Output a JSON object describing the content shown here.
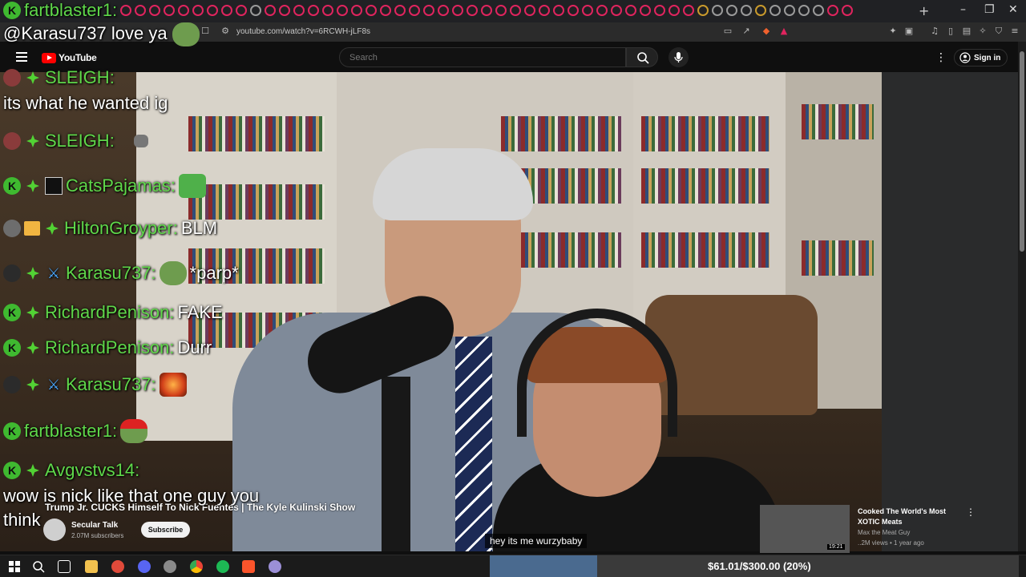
{
  "browser": {
    "url": "youtube.com/watch?v=6RCWH-jLF8s",
    "window_controls": [
      "–",
      "❐",
      "✕"
    ],
    "new_tab_label": "+"
  },
  "youtube": {
    "logo_text": "YouTube",
    "search_placeholder": "Search",
    "sign_in_label": "Sign in"
  },
  "chat": {
    "messages": [
      {
        "user": "fartblaster1:",
        "text": ""
      },
      {
        "user": "",
        "text": "@Karasu737 love ya"
      },
      {
        "user": "SLEIGH:",
        "text": ""
      },
      {
        "user": "",
        "text": "its what he wanted ig"
      },
      {
        "user": "SLEIGH:",
        "text": ""
      },
      {
        "user": "CatsPajamas:",
        "text": ""
      },
      {
        "user": "HiltonGroyper:",
        "text": "BLM"
      },
      {
        "user": "Karasu737:",
        "text": "*parp*"
      },
      {
        "user": "RichardPenison:",
        "text": "FAKE"
      },
      {
        "user": "RichardPenison:",
        "text": "Durr"
      },
      {
        "user": "Karasu737:",
        "text": ""
      },
      {
        "user": "fartblaster1:",
        "text": ""
      },
      {
        "user": "Avgvstvs14:",
        "text": ""
      },
      {
        "user": "",
        "text": "wow is nick like that one guy you"
      },
      {
        "user": "",
        "text": "think"
      }
    ]
  },
  "video": {
    "title": "Trump Jr. CUCKS Himself To Nick Fuentes | The Kyle Kulinski Show",
    "channel_name": "Secular Talk",
    "subscribers": "2.07M subscribers",
    "subscribe_label": "Subscribe",
    "caption": "hey its me wurzybaby"
  },
  "recommended": {
    "title": "Cooked The World's Most XOTIC Meats",
    "channel": "Max the Meat Guy",
    "meta": "..2M views • 1 year ago",
    "duration": "19:21"
  },
  "goal": {
    "text": "$61.01/$300.00 (20%)",
    "progress": 0.2034
  },
  "colors": {
    "chat_username": "#5fd84a",
    "badge_green": "#3fb930",
    "yt_red": "#ff0000",
    "goal_fill": "#4a6a8f"
  }
}
